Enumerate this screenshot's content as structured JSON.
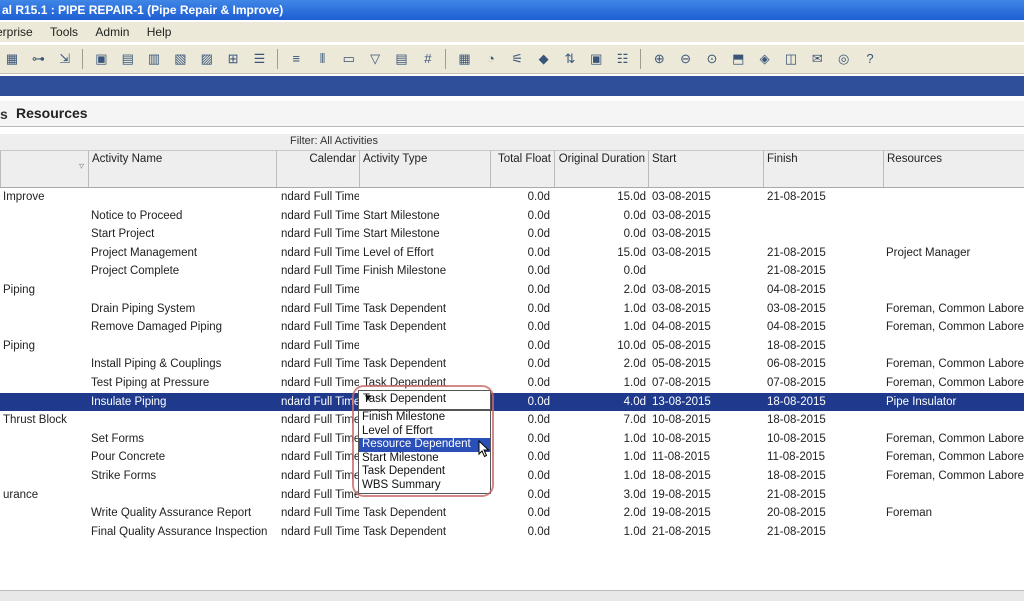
{
  "window": {
    "title": "al R15.1 : PIPE REPAIR-1 (Pipe Repair & Improve)"
  },
  "menu": [
    "erprise",
    "Tools",
    "Admin",
    "Help"
  ],
  "toolbar_icons": [
    "gantt-icon",
    "trace-icon",
    "network-icon",
    "chart-icon",
    "bar-icon",
    "bar2-icon",
    "progress-icon",
    "tree-icon",
    "filter-icon",
    "columns-icon",
    "layout-icon",
    "hash-icon",
    "print-icon",
    "zoom-in-icon",
    "zoom-out-icon",
    "fit-icon",
    "split-icon",
    "notes-icon",
    "help-icon"
  ],
  "section": {
    "prefix": "s",
    "title": "Resources"
  },
  "filter": "Filter: All Activities",
  "columns": {
    "activity_name": "Activity Name",
    "calendar": "Calendar",
    "activity_type": "Activity Type",
    "total_float": "Total Float",
    "original_duration": "Original Duration",
    "start": "Start",
    "finish": "Finish",
    "resources": "Resources"
  },
  "rows": [
    {
      "wbs": "Improve",
      "name": "",
      "cal": "ndard Full Time",
      "type": "",
      "tf": "0.0d",
      "od": "15.0d",
      "start": "03-08-2015",
      "finish": "21-08-2015",
      "res": ""
    },
    {
      "wbs": "",
      "name": "Notice to Proceed",
      "cal": "ndard Full Time",
      "type": "Start Milestone",
      "tf": "0.0d",
      "od": "0.0d",
      "start": "03-08-2015",
      "finish": "",
      "res": ""
    },
    {
      "wbs": "",
      "name": "Start Project",
      "cal": "ndard Full Time",
      "type": "Start Milestone",
      "tf": "0.0d",
      "od": "0.0d",
      "start": "03-08-2015",
      "finish": "",
      "res": ""
    },
    {
      "wbs": "",
      "name": "Project Management",
      "cal": "ndard Full Time",
      "type": "Level of Effort",
      "tf": "0.0d",
      "od": "15.0d",
      "start": "03-08-2015",
      "finish": "21-08-2015",
      "res": "Project Manager"
    },
    {
      "wbs": "",
      "name": "Project Complete",
      "cal": "ndard Full Time",
      "type": "Finish Milestone",
      "tf": "0.0d",
      "od": "0.0d",
      "start": "",
      "finish": "21-08-2015",
      "res": ""
    },
    {
      "wbs": "Piping",
      "name": "",
      "cal": "ndard Full Time",
      "type": "",
      "tf": "0.0d",
      "od": "2.0d",
      "start": "03-08-2015",
      "finish": "04-08-2015",
      "res": ""
    },
    {
      "wbs": "",
      "name": "Drain Piping System",
      "cal": "ndard Full Time",
      "type": "Task Dependent",
      "tf": "0.0d",
      "od": "1.0d",
      "start": "03-08-2015",
      "finish": "03-08-2015",
      "res": "Foreman, Common Laborer,"
    },
    {
      "wbs": "",
      "name": "Remove Damaged Piping",
      "cal": "ndard Full Time",
      "type": "Task Dependent",
      "tf": "0.0d",
      "od": "1.0d",
      "start": "04-08-2015",
      "finish": "04-08-2015",
      "res": "Foreman, Common Laborer,"
    },
    {
      "wbs": "Piping",
      "name": "",
      "cal": "ndard Full Time",
      "type": "",
      "tf": "0.0d",
      "od": "10.0d",
      "start": "05-08-2015",
      "finish": "18-08-2015",
      "res": ""
    },
    {
      "wbs": "",
      "name": "Install Piping & Couplings",
      "cal": "ndard Full Time",
      "type": "Task Dependent",
      "tf": "0.0d",
      "od": "2.0d",
      "start": "05-08-2015",
      "finish": "06-08-2015",
      "res": "Foreman, Common Laborer,"
    },
    {
      "wbs": "",
      "name": "Test Piping at Pressure",
      "cal": "ndard Full Time",
      "type": "Task Dependent",
      "tf": "0.0d",
      "od": "1.0d",
      "start": "07-08-2015",
      "finish": "07-08-2015",
      "res": "Foreman, Common Laborer,"
    },
    {
      "wbs": "",
      "name": "Insulate Piping",
      "cal": "ndard Full Time",
      "type": "Task Dependent",
      "tf": "0.0d",
      "od": "4.0d",
      "start": "13-08-2015",
      "finish": "18-08-2015",
      "res": "Pipe Insulator",
      "selected": true
    },
    {
      "wbs": "Thrust Block",
      "name": "",
      "cal": "ndard Full Time",
      "type": "",
      "tf": "0.0d",
      "od": "7.0d",
      "start": "10-08-2015",
      "finish": "18-08-2015",
      "res": ""
    },
    {
      "wbs": "",
      "name": "Set Forms",
      "cal": "ndard Full Time",
      "type": "",
      "tf": "0.0d",
      "od": "1.0d",
      "start": "10-08-2015",
      "finish": "10-08-2015",
      "res": "Foreman, Common Laborer,"
    },
    {
      "wbs": "",
      "name": "Pour Concrete",
      "cal": "ndard Full Time",
      "type": "",
      "tf": "0.0d",
      "od": "1.0d",
      "start": "11-08-2015",
      "finish": "11-08-2015",
      "res": "Foreman, Common Laborer,"
    },
    {
      "wbs": "",
      "name": "Strike Forms",
      "cal": "ndard Full Time",
      "type": "",
      "tf": "0.0d",
      "od": "1.0d",
      "start": "18-08-2015",
      "finish": "18-08-2015",
      "res": "Foreman, Common Laborer"
    },
    {
      "wbs": "urance",
      "name": "",
      "cal": "ndard Full Time",
      "type": "",
      "tf": "0.0d",
      "od": "3.0d",
      "start": "19-08-2015",
      "finish": "21-08-2015",
      "res": ""
    },
    {
      "wbs": "",
      "name": "Write Quality Assurance Report",
      "cal": "ndard Full Time",
      "type": "Task Dependent",
      "tf": "0.0d",
      "od": "2.0d",
      "start": "19-08-2015",
      "finish": "20-08-2015",
      "res": "Foreman"
    },
    {
      "wbs": "",
      "name": "Final Quality Assurance Inspection",
      "cal": "ndard Full Time",
      "type": "Task Dependent",
      "tf": "0.0d",
      "od": "1.0d",
      "start": "21-08-2015",
      "finish": "21-08-2015",
      "res": ""
    }
  ],
  "dropdown": {
    "value": "Task Dependent",
    "options": [
      "Finish Milestone",
      "Level of Effort",
      "Resource Dependent",
      "Start Milestone",
      "Task Dependent",
      "WBS Summary"
    ],
    "highlighted": 2
  },
  "colors": {
    "title_bar": "#1f5ed4",
    "selection": "#1f3a8c",
    "highlight": "#2a50b8"
  }
}
